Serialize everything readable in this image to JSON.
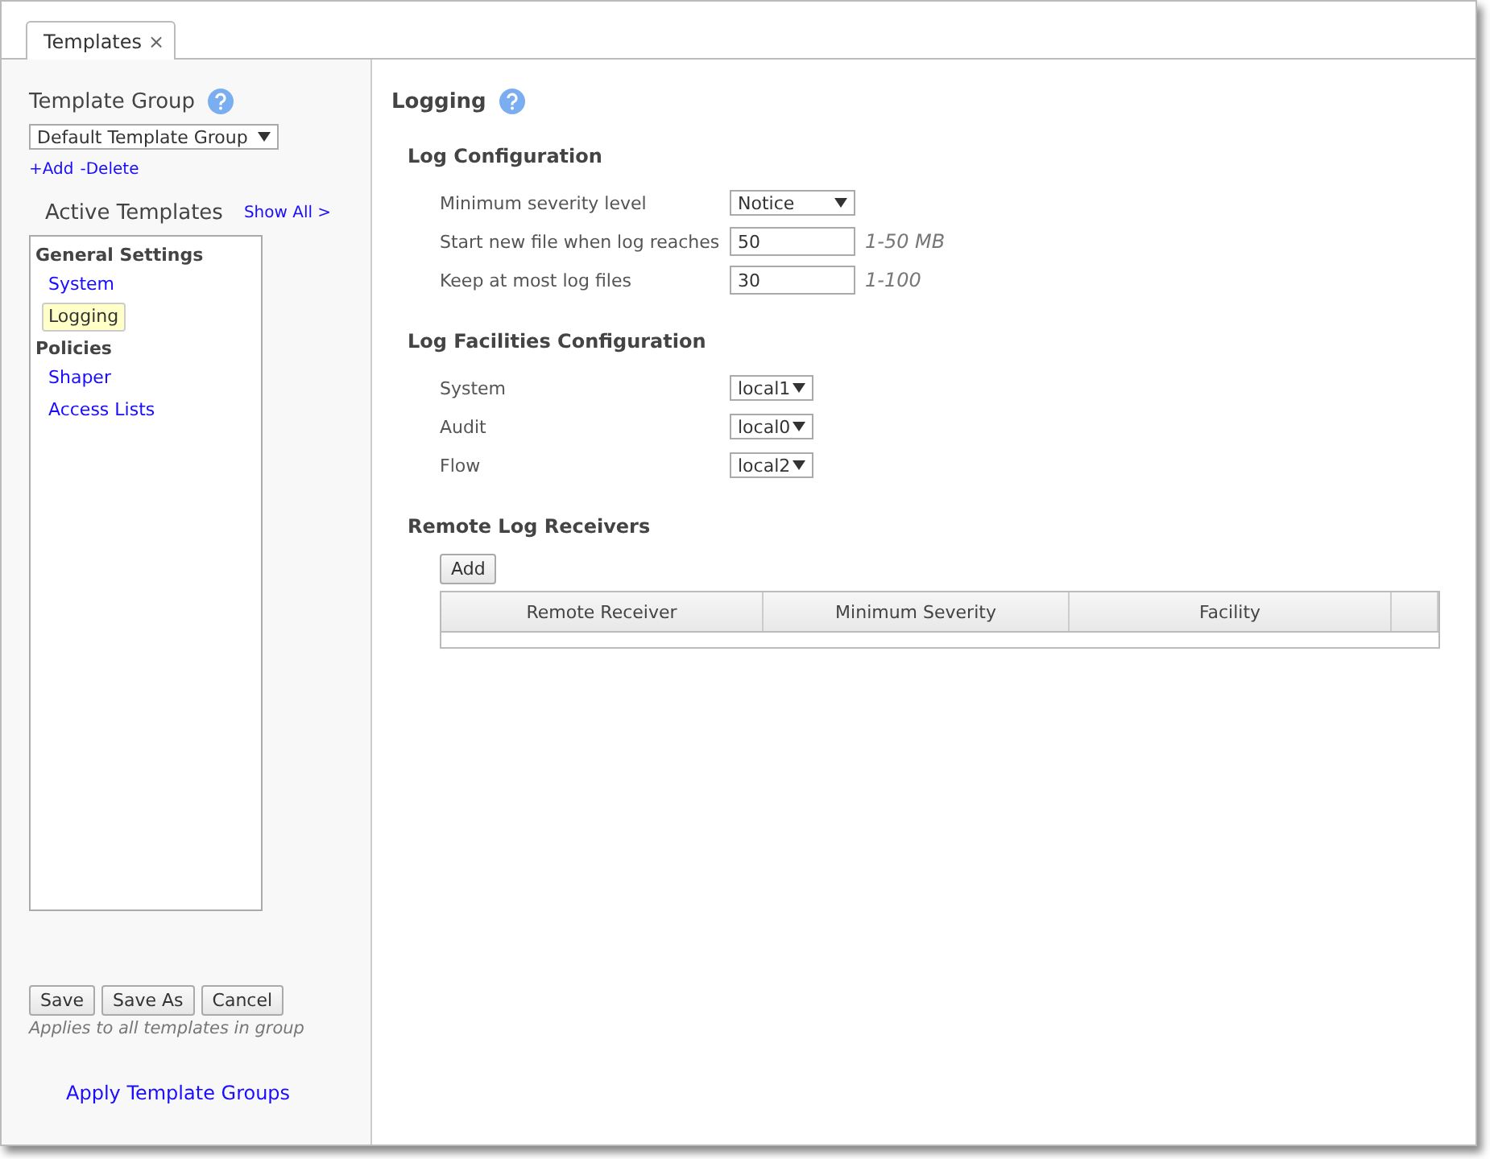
{
  "tabs": [
    {
      "label": "Templates",
      "close": "×",
      "selected": true
    }
  ],
  "sidebar": {
    "group_title": "Template Group",
    "group_select": "Default Template Group",
    "links": [
      "+Add",
      "-Delete"
    ],
    "active_title": "Active Templates",
    "show_all": "Show All >",
    "tree": [
      {
        "label": "General Settings",
        "children": [
          {
            "label": "System",
            "selected": false
          },
          {
            "label": "Logging",
            "selected": true
          }
        ]
      },
      {
        "label": "Policies",
        "children": [
          {
            "label": "Shaper",
            "selected": false
          },
          {
            "label": "Access Lists",
            "selected": false
          }
        ]
      }
    ],
    "buttons": [
      "Save",
      "Save As",
      "Cancel"
    ],
    "note": "Applies to all templates in group",
    "apply_link": "Apply Template Groups"
  },
  "main": {
    "title": "Logging",
    "sections": [
      {
        "title": "Log Configuration",
        "rows": [
          {
            "kind": "select",
            "label": "Minimum severity level",
            "value": "Notice"
          },
          {
            "kind": "input",
            "label": "Start new file when log reaches",
            "value": "50",
            "hint": "1-50 MB"
          },
          {
            "kind": "input",
            "label": "Keep at most log files",
            "value": "30",
            "hint": "1-100"
          }
        ]
      },
      {
        "title": "Log Facilities Configuration",
        "rows": [
          {
            "kind": "small-select",
            "label": "System",
            "value": "local1"
          },
          {
            "kind": "small-select",
            "label": "Audit",
            "value": "local0"
          },
          {
            "kind": "small-select",
            "label": "Flow",
            "value": "local2"
          }
        ]
      }
    ],
    "receivers": {
      "title": "Remote Log Receivers",
      "add": "Add",
      "columns": [
        "Remote Receiver",
        "Minimum Severity",
        "Facility"
      ]
    }
  }
}
